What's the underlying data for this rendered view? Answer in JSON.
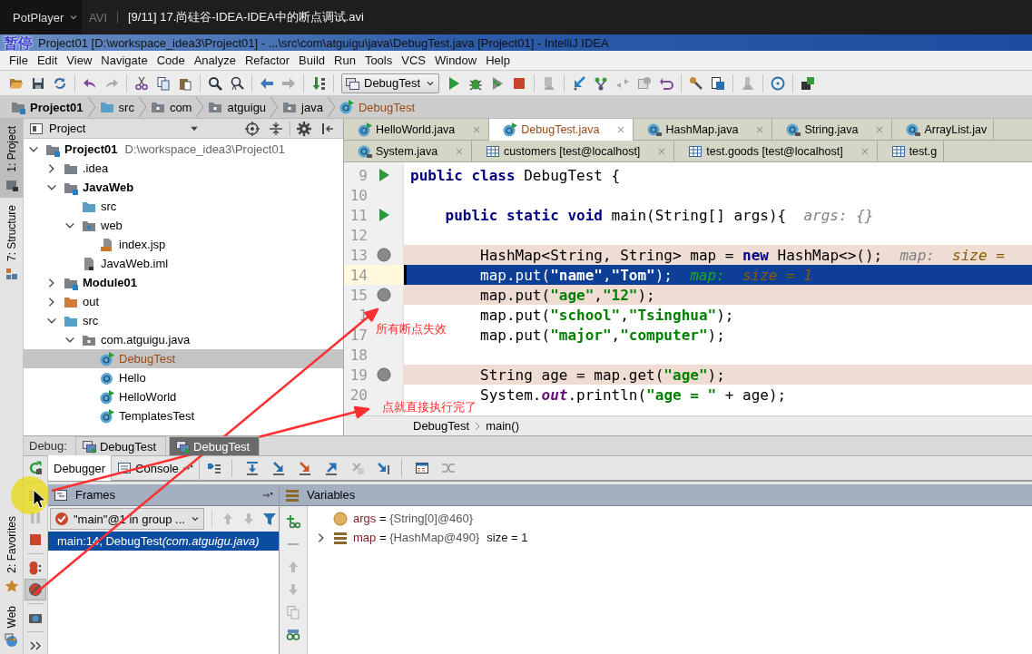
{
  "player": {
    "app": "PotPlayer",
    "format": "AVI",
    "title": "[9/11] 17.尚硅谷-IDEA-IDEA中的断点调试.avi",
    "osd": "暂停"
  },
  "window": {
    "title": "Project01 [D:\\workspace_idea3\\Project01] - ...\\src\\com\\atguigu\\java\\DebugTest.java [Project01] - IntelliJ IDEA"
  },
  "menu": [
    "File",
    "Edit",
    "View",
    "Navigate",
    "Code",
    "Analyze",
    "Refactor",
    "Build",
    "Run",
    "Tools",
    "VCS",
    "Window",
    "Help"
  ],
  "toolbar": {
    "run_config": "DebugTest"
  },
  "navbar": [
    {
      "label": "Project01",
      "kind": "module",
      "modified": false
    },
    {
      "label": "src",
      "kind": "source",
      "modified": false
    },
    {
      "label": "com",
      "kind": "package",
      "modified": false
    },
    {
      "label": "atguigu",
      "kind": "package",
      "modified": false
    },
    {
      "label": "java",
      "kind": "package",
      "modified": false
    },
    {
      "label": "DebugTest",
      "kind": "runnable",
      "modified": true
    }
  ],
  "side_strip": {
    "top": [
      {
        "label": "1: Project",
        "selected": true
      },
      {
        "label": "7: Structure",
        "selected": false
      }
    ],
    "bottom": [
      {
        "label": "2: Favorites",
        "selected": false
      },
      {
        "label": "Web",
        "selected": false
      }
    ]
  },
  "project": {
    "title": "Project",
    "tree": [
      {
        "label": "Project01",
        "note": "D:\\workspace_idea3\\Project01",
        "kind": "module",
        "expanded": true,
        "selected": false,
        "modified": false,
        "children": [
          {
            "label": ".idea",
            "kind": "folder",
            "expanded": false,
            "selected": false,
            "modified": false
          },
          {
            "label": "JavaWeb",
            "kind": "module",
            "expanded": true,
            "selected": false,
            "modified": false,
            "children": [
              {
                "label": "src",
                "kind": "source",
                "selected": false,
                "modified": false
              },
              {
                "label": "web",
                "kind": "web",
                "expanded": true,
                "selected": false,
                "modified": false,
                "children": [
                  {
                    "label": "index.jsp",
                    "kind": "jsp",
                    "selected": false,
                    "modified": false
                  }
                ]
              },
              {
                "label": "JavaWeb.iml",
                "kind": "iml",
                "selected": false,
                "modified": false
              }
            ]
          },
          {
            "label": "Module01",
            "kind": "module",
            "expanded": false,
            "selected": false,
            "modified": false
          },
          {
            "label": "out",
            "kind": "excluded",
            "expanded": false,
            "selected": false,
            "modified": false
          },
          {
            "label": "src",
            "kind": "source",
            "expanded": true,
            "selected": false,
            "modified": false,
            "children": [
              {
                "label": "com.atguigu.java",
                "kind": "package",
                "expanded": true,
                "selected": false,
                "modified": false,
                "children": [
                  {
                    "label": "DebugTest",
                    "kind": "runnable",
                    "selected": true,
                    "modified": true
                  },
                  {
                    "label": "Hello",
                    "kind": "class",
                    "selected": false,
                    "modified": false
                  },
                  {
                    "label": "HelloWorld",
                    "kind": "runnable",
                    "selected": false,
                    "modified": false
                  },
                  {
                    "label": "TemplatesTest",
                    "kind": "runnable",
                    "selected": false,
                    "modified": false
                  }
                ]
              }
            ]
          }
        ]
      }
    ]
  },
  "editor": {
    "tab_rows": [
      {
        "tabs": [
          {
            "label": "HelloWorld.java",
            "kind": "runnable",
            "selected": false,
            "modified": false,
            "closable": true
          },
          {
            "label": "DebugTest.java",
            "kind": "runnable",
            "selected": true,
            "modified": true,
            "closable": true
          },
          {
            "label": "HashMap.java",
            "kind": "library",
            "selected": false,
            "modified": false,
            "closable": true
          },
          {
            "label": "String.java",
            "kind": "library",
            "selected": false,
            "modified": false,
            "closable": true
          },
          {
            "label": "ArrayList.jav",
            "kind": "library",
            "selected": false,
            "modified": false,
            "closable": false
          }
        ]
      },
      {
        "tabs": [
          {
            "label": "System.java",
            "kind": "library",
            "selected": false,
            "modified": false,
            "closable": true
          },
          {
            "label": "customers [test@localhost]",
            "kind": "table",
            "selected": false,
            "modified": false,
            "closable": true
          },
          {
            "label": "test.goods [test@localhost]",
            "kind": "table",
            "selected": false,
            "modified": false,
            "closable": true
          },
          {
            "label": "test.g",
            "kind": "table",
            "selected": false,
            "modified": false,
            "closable": false
          }
        ]
      }
    ],
    "lines": [
      {
        "number": "9",
        "runnable": true,
        "breakpoint": false,
        "current": false,
        "code": [
          {
            "kind": "keyword",
            "text": "public class"
          },
          {
            "kind": "plain",
            "text": " DebugTest {"
          }
        ]
      },
      {
        "number": "10",
        "runnable": false,
        "breakpoint": false,
        "current": false
      },
      {
        "number": "11",
        "runnable": true,
        "breakpoint": false,
        "current": false,
        "code": [
          {
            "kind": "keyword",
            "text": "    public static void"
          },
          {
            "kind": "plain",
            "text": " main(String[] args){"
          }
        ],
        "hint": [
          {
            "kind": "label",
            "text": "args: {}"
          }
        ]
      },
      {
        "number": "12",
        "runnable": false,
        "breakpoint": false,
        "current": false
      },
      {
        "number": "13",
        "runnable": false,
        "breakpoint": true,
        "current": false,
        "code": [
          {
            "kind": "plain",
            "text": "        HashMap<String, String> map = "
          },
          {
            "kind": "keyword",
            "text": "new"
          },
          {
            "kind": "plain",
            "text": " HashMap<>();"
          }
        ],
        "hint": [
          {
            "kind": "label",
            "text": "map:"
          },
          {
            "kind": "value",
            "text": "size ="
          }
        ]
      },
      {
        "number": "14",
        "runnable": false,
        "breakpoint": false,
        "current": true,
        "code": [
          {
            "kind": "plain",
            "text": "        map.put("
          },
          {
            "kind": "string",
            "text": "\"name\""
          },
          {
            "kind": "plain",
            "text": ","
          },
          {
            "kind": "string",
            "text": "\"Tom\""
          },
          {
            "kind": "plain",
            "text": ");"
          }
        ],
        "hint": [
          {
            "kind": "label",
            "text": "map:"
          },
          {
            "kind": "value",
            "text": "size = 1"
          }
        ]
      },
      {
        "number": "15",
        "runnable": false,
        "breakpoint": true,
        "current": false,
        "code": [
          {
            "kind": "plain",
            "text": "        map.put("
          },
          {
            "kind": "string",
            "text": "\"age\""
          },
          {
            "kind": "plain",
            "text": ","
          },
          {
            "kind": "string",
            "text": "\"12\""
          },
          {
            "kind": "plain",
            "text": ");"
          }
        ]
      },
      {
        "number": "1",
        "runnable": false,
        "breakpoint": false,
        "current": false,
        "code": [
          {
            "kind": "plain",
            "text": "        map.put("
          },
          {
            "kind": "string",
            "text": "\"school\""
          },
          {
            "kind": "plain",
            "text": ","
          },
          {
            "kind": "string",
            "text": "\"Tsinghua\""
          },
          {
            "kind": "plain",
            "text": ");"
          }
        ]
      },
      {
        "number": "17",
        "runnable": false,
        "breakpoint": false,
        "current": false,
        "code": [
          {
            "kind": "plain",
            "text": "        map.put("
          },
          {
            "kind": "string",
            "text": "\"major\""
          },
          {
            "kind": "plain",
            "text": ","
          },
          {
            "kind": "string",
            "text": "\"computer\""
          },
          {
            "kind": "plain",
            "text": ");"
          }
        ]
      },
      {
        "number": "18",
        "runnable": false,
        "breakpoint": false,
        "current": false
      },
      {
        "number": "19",
        "runnable": false,
        "breakpoint": true,
        "current": false,
        "code": [
          {
            "kind": "plain",
            "text": "        String age = map.get("
          },
          {
            "kind": "string",
            "text": "\"age\""
          },
          {
            "kind": "plain",
            "text": ");"
          }
        ]
      },
      {
        "number": "20",
        "runnable": false,
        "breakpoint": false,
        "current": false,
        "code": [
          {
            "kind": "plain",
            "text": "        System."
          },
          {
            "kind": "field",
            "text": "out"
          },
          {
            "kind": "plain",
            "text": ".println("
          },
          {
            "kind": "string",
            "text": "\"age = \""
          },
          {
            "kind": "plain",
            "text": " + age);"
          }
        ]
      }
    ],
    "breadcrumb": [
      "DebugTest",
      "main()"
    ]
  },
  "debug": {
    "label": "Debug:",
    "breakpoints_muted": true,
    "sessions": [
      {
        "label": "DebugTest",
        "selected": false
      },
      {
        "label": "DebugTest",
        "selected": true
      }
    ],
    "tabs": [
      {
        "label": "Debugger",
        "selected": true
      },
      {
        "label": "Console",
        "selected": false
      }
    ],
    "frames": {
      "title": "Frames",
      "thread": "\"main\"@1 in group ...",
      "items": [
        {
          "location": "main:14, DebugTest",
          "package": "(com.atguigu.java)",
          "selected": true
        }
      ]
    },
    "variables": {
      "title": "Variables",
      "items": [
        {
          "kind": "param",
          "name": "args",
          "operator": "=",
          "value": "{String[0]@460}",
          "expandable": false
        },
        {
          "kind": "field",
          "name": "map",
          "operator": "=",
          "value": "{HashMap@490}",
          "extra": "size = 1",
          "expandable": true
        }
      ]
    }
  },
  "annotations": [
    {
      "text": "所有断点失效"
    },
    {
      "text": "点就直接执行完了"
    }
  ]
}
